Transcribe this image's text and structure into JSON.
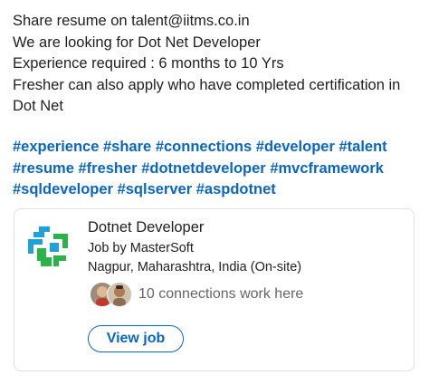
{
  "post": {
    "lines": [
      "Share resume on talent@iitms.co.in",
      "We are looking for Dot Net Developer",
      "Experience required : 6 months to 10 Yrs",
      "Fresher can also apply who have completed certification in",
      "Dot Net"
    ],
    "hashtag_lines": [
      [
        "#experience",
        "#share",
        "#connections",
        "#developer",
        "#talent"
      ],
      [
        "#resume",
        "#fresher",
        "#dotnetdeveloper",
        "#mvcframework"
      ],
      [
        "#sqldeveloper",
        "#sqlserver",
        "#aspdotnet"
      ]
    ]
  },
  "job_card": {
    "title": "Dotnet Developer",
    "company": "Job by MasterSoft",
    "location": "Nagpur, Maharashtra, India (On-site)",
    "connections_text": "10 connections work here",
    "view_job_label": "View job",
    "logo_icon": "mastersoft-logo",
    "colors": {
      "logo_blue": "#1fa1d8",
      "logo_green": "#2bb34a",
      "link_blue": "#0a66c2"
    }
  }
}
